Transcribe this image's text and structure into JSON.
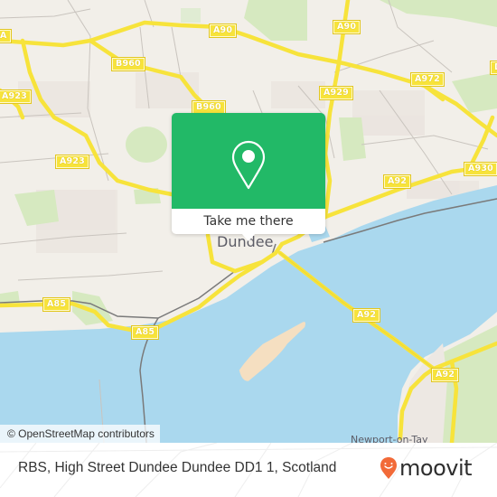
{
  "map": {
    "colors": {
      "land": "#f2efe9",
      "water": "#aad8ee",
      "park": "#d6e9c0",
      "road_major": "#f7e33b",
      "sandbank": "#f5dfc1",
      "popup_green": "#22b967",
      "moovit_orange": "#f26a38"
    },
    "road_labels": {
      "a90_left": "A90",
      "a90_right": "A90",
      "b960_top": "B960",
      "b960_mid": "B960",
      "a923_left": "A923",
      "a923_mid": "A923",
      "a929": "A929",
      "a972": "A972",
      "a930": "A930",
      "a92_east": "A92",
      "a92_bridge": "A92",
      "a92_south": "A92",
      "a85_west": "A85",
      "a85_south": "A85",
      "edge_left": "A",
      "edge_right": "D"
    },
    "place_labels": {
      "city": "Dundee",
      "town": "Newport-on-Tay"
    },
    "attribution": "© OpenStreetMap contributors"
  },
  "popup": {
    "icon": "map-pin-icon",
    "button_label": "Take me there"
  },
  "footer": {
    "address": "RBS, High Street Dundee Dundee DD1 1, Scotland",
    "brand": "moovit",
    "brand_icon": "moovit-pin-smile-icon"
  }
}
